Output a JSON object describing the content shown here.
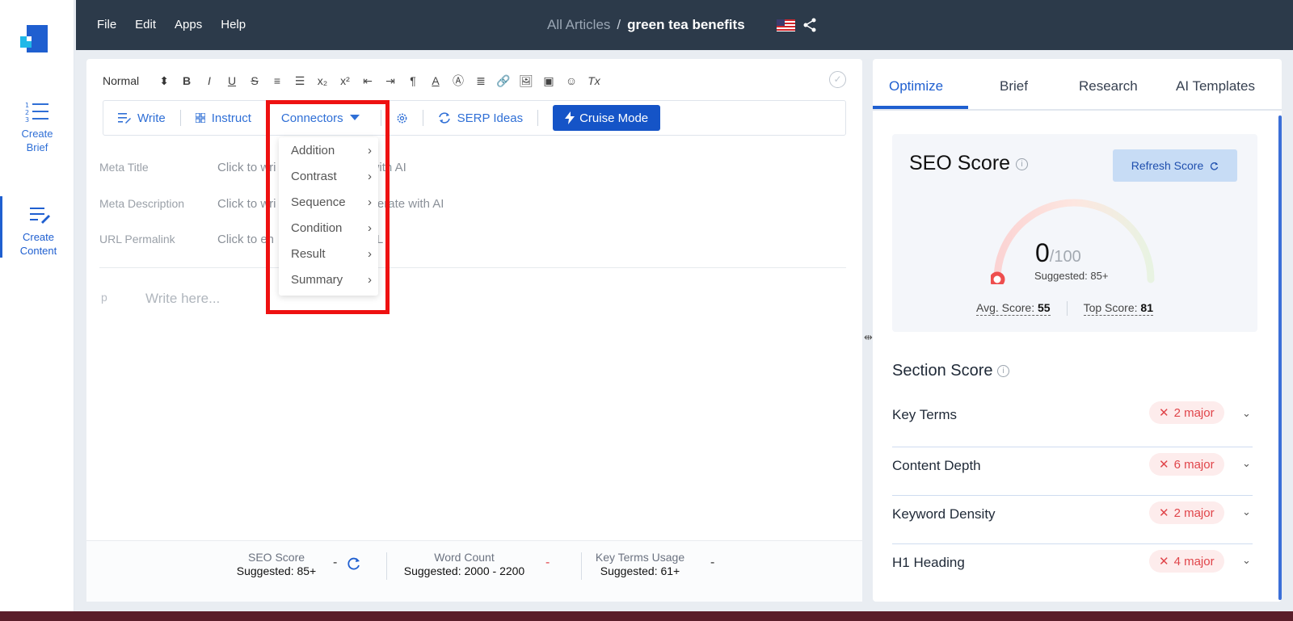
{
  "app": {
    "accent": "#1554c7",
    "topbar_color": "#2c3a4a"
  },
  "rail": {
    "items": [
      {
        "label_1": "Create",
        "label_2": "Brief",
        "icon": "numbered-list-icon"
      },
      {
        "label_1": "Create",
        "label_2": "Content",
        "icon": "edit-lines-icon"
      }
    ]
  },
  "topbar": {
    "menu": [
      "File",
      "Edit",
      "Apps",
      "Help"
    ],
    "breadcrumb_root": "All Articles",
    "breadcrumb_sep": "/",
    "document_title": "green tea benefits",
    "flag_icon": "us-flag-icon",
    "share_icon": "share-icon"
  },
  "toolbar": {
    "style_select": "Normal",
    "style_arrows": "⬍",
    "icons": [
      "B",
      "I",
      "U",
      "S",
      "≡",
      "☰",
      "x₂",
      "x²",
      "⇤",
      "⇥",
      "¶",
      "A",
      "Ⓐ",
      "≣",
      "🔗",
      "🖼",
      "▣",
      "☺",
      "Tx"
    ]
  },
  "actions": {
    "write": "Write",
    "instruct": "Instruct",
    "connectors": "Connectors",
    "serp_ideas": "SERP Ideas",
    "cruise_mode": "Cruise Mode"
  },
  "connectors_menu": [
    "Addition",
    "Contrast",
    "Sequence",
    "Condition",
    "Result",
    "Summary"
  ],
  "meta": {
    "title_label": "Meta Title",
    "title_placeholder_a": "Click to wri",
    "title_placeholder_b": "enerate with AI",
    "desc_label": "Meta Description",
    "desc_placeholder_a": "Click to wri",
    "desc_placeholder_b": "on or generate with AI",
    "url_label": "URL Permalink",
    "url_placeholder_a": "Click to en",
    "url_placeholder_b": "r URL"
  },
  "body": {
    "para_tag": "p",
    "placeholder": "Write here..."
  },
  "stats": {
    "seo_label": "SEO Score",
    "seo_suggested": "Suggested: 85+",
    "seo_value": "-",
    "wc_label": "Word Count",
    "wc_suggested": "Suggested: 2000 - 2200",
    "wc_value": "-",
    "kt_label": "Key Terms Usage",
    "kt_suggested": "Suggested: 61+",
    "kt_value": "-"
  },
  "right_panel": {
    "tabs": [
      "Optimize",
      "Brief",
      "Research",
      "AI Templates"
    ],
    "active_tab": "Optimize",
    "seo_title": "SEO Score",
    "refresh_label": "Refresh Score",
    "score": "0",
    "score_den": "/100",
    "score_fraction": 0,
    "suggested": "Suggested: 85+",
    "avg_label": "Avg. Score:",
    "avg_value": "55",
    "top_label": "Top Score:",
    "top_value": "81",
    "section_title": "Section Score",
    "sections": [
      {
        "label": "Key Terms",
        "badge": "2 major"
      },
      {
        "label": "Content Depth",
        "badge": "6 major"
      },
      {
        "label": "Keyword Density",
        "badge": "2 major"
      },
      {
        "label": "H1 Heading",
        "badge": "4 major"
      }
    ]
  }
}
